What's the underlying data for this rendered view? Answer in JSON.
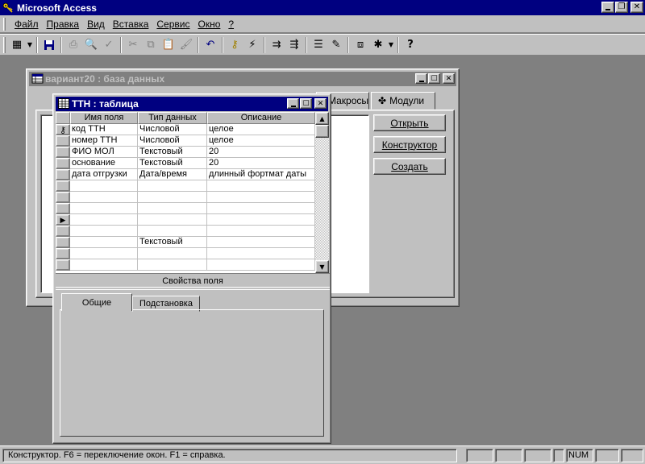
{
  "app": {
    "title": "Microsoft Access"
  },
  "menu": [
    "Файл",
    "Правка",
    "Вид",
    "Вставка",
    "Сервис",
    "Окно",
    "?"
  ],
  "db_window": {
    "title": "вариант20 : база данных",
    "tabs": [
      "Макросы",
      "Модули"
    ],
    "buttons": {
      "open": "Открыть",
      "design": "Конструктор",
      "create": "Создать"
    }
  },
  "table_window": {
    "title": "ТТН : таблица",
    "columns": [
      "Имя поля",
      "Тип данных",
      "Описание"
    ],
    "rows": [
      {
        "name": "код ТТН",
        "type": "Числовой",
        "desc": "целое"
      },
      {
        "name": "номер ТТН",
        "type": "Числовой",
        "desc": "целое"
      },
      {
        "name": "ФИО МОЛ",
        "type": "Текстовый",
        "desc": "20"
      },
      {
        "name": "основание",
        "type": "Текстовый",
        "desc": "20"
      },
      {
        "name": "дата отгрузки",
        "type": "Дата/время",
        "desc": "длинный фортмат даты"
      },
      {
        "name": "",
        "type": "",
        "desc": ""
      },
      {
        "name": "",
        "type": "",
        "desc": ""
      },
      {
        "name": "",
        "type": "",
        "desc": ""
      },
      {
        "name": "",
        "type": "",
        "desc": ""
      },
      {
        "name": "",
        "type": "",
        "desc": ""
      },
      {
        "name": "",
        "type": "Текстовый",
        "desc": ""
      },
      {
        "name": "",
        "type": "",
        "desc": ""
      },
      {
        "name": "",
        "type": "",
        "desc": ""
      }
    ],
    "field_properties_label": "Свойства поля",
    "property_tabs": [
      "Общие",
      "Подстановка"
    ]
  },
  "status": {
    "text": "Конструктор.  F6 = переключение окон.  F1 = справка.",
    "num": "NUM"
  }
}
